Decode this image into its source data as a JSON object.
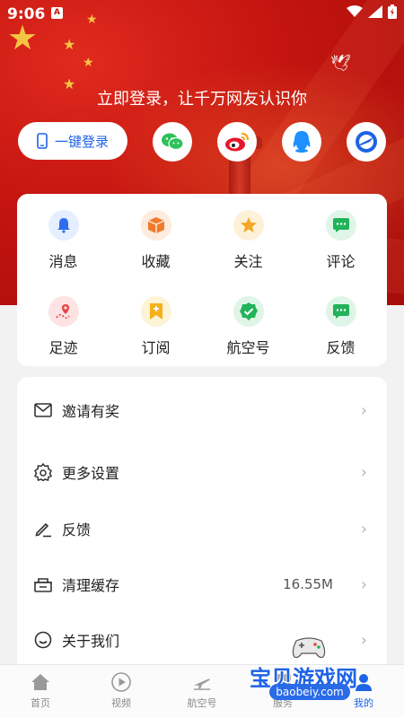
{
  "status_bar": {
    "time": "9:06",
    "sim_badge": "A"
  },
  "header": {
    "login_hint": "立即登录，让千万网友认识你",
    "one_key_login_label": "一键登录",
    "social_logins": [
      {
        "name": "wechat-icon"
      },
      {
        "name": "weibo-icon"
      },
      {
        "name": "qq-icon"
      },
      {
        "name": "hangkong-icon"
      }
    ]
  },
  "grid": {
    "items": [
      {
        "label": "消息",
        "icon": "bell-icon",
        "color": "#2f6df0",
        "bg": "#e6efff"
      },
      {
        "label": "收藏",
        "icon": "box-icon",
        "color": "#f07a2a",
        "bg": "#fdebdd"
      },
      {
        "label": "关注",
        "icon": "star-icon",
        "color": "#f5a623",
        "bg": "#fdf1d8"
      },
      {
        "label": "评论",
        "icon": "chat-icon",
        "color": "#22b35a",
        "bg": "#dff5e7"
      },
      {
        "label": "足迹",
        "icon": "footprint-icon",
        "color": "#e64545",
        "bg": "#fde3e3"
      },
      {
        "label": "订阅",
        "icon": "bookmark-icon",
        "color": "#f5b01c",
        "bg": "#fdf3d6"
      },
      {
        "label": "航空号",
        "icon": "verified-icon",
        "color": "#22b35a",
        "bg": "#dff5e7"
      },
      {
        "label": "反馈",
        "icon": "feedback-chat-icon",
        "color": "#22b35a",
        "bg": "#dff5e7"
      }
    ]
  },
  "list": {
    "items": [
      {
        "label": "邀请有奖",
        "icon": "mail-icon",
        "value": ""
      },
      {
        "label": "更多设置",
        "icon": "settings-icon",
        "value": ""
      },
      {
        "label": "反馈",
        "icon": "edit-icon",
        "value": ""
      },
      {
        "label": "清理缓存",
        "icon": "cache-icon",
        "value": "16.55M"
      },
      {
        "label": "关于我们",
        "icon": "smile-icon",
        "value": ""
      }
    ]
  },
  "bottom_nav": {
    "items": [
      {
        "label": "首页",
        "icon": "home-icon"
      },
      {
        "label": "视频",
        "icon": "video-icon"
      },
      {
        "label": "航空号",
        "icon": "plane-icon"
      },
      {
        "label": "服务",
        "icon": "service-icon"
      },
      {
        "label": "我的",
        "icon": "profile-icon"
      }
    ]
  },
  "watermark": {
    "text": "宝贝游戏网",
    "url": "baobeiy.com"
  },
  "colors": {
    "accent": "#1e63e6",
    "banner_red": "#c3140f",
    "background": "#f2f2f2"
  }
}
